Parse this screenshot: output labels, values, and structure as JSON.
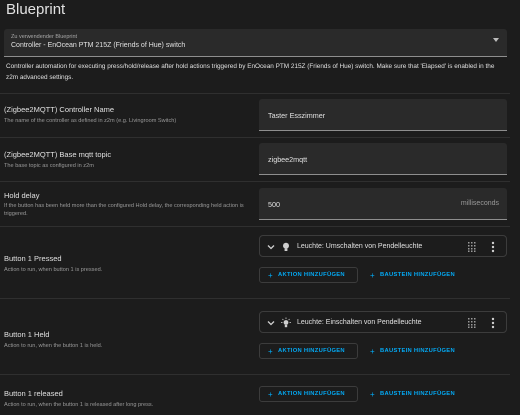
{
  "page": {
    "title": "Blueprint"
  },
  "blueprint_select": {
    "label": "Zu verwendender Blueprint",
    "value": "Controller - EnOcean PTM 215Z (Friends of Hue) switch"
  },
  "description": "Controller automation for executing press/hold/release after hold actions triggered by EnOcean PTM 215Z (Friends of Hue) switch. Make sure that 'Elapsed' is enabled in the z2m advanced settings.",
  "fields": [
    {
      "title": "(Zigbee2MQTT) Controller Name",
      "subtitle": "The name of the controller as defined in z2m (e.g. Livingroom Switch)",
      "value": "Taster Esszimmer"
    },
    {
      "title": "(Zigbee2MQTT) Base mqtt topic",
      "subtitle": "The base topic as configured in z2m",
      "value": "zigbee2mqtt"
    },
    {
      "title": "Hold delay",
      "subtitle": "If the button has been held more than the configured Hold delay, the corresponding held action is triggered.",
      "value": "500",
      "suffix": "milliseconds"
    }
  ],
  "actions": [
    {
      "title": "Button 1 Pressed",
      "subtitle": "Action to run, when button 1 is pressed.",
      "card": "Leuchte: Umschalten von Pendelleuchte"
    },
    {
      "title": "Button 1 Held",
      "subtitle": "Action to run, when the button 1 is held.",
      "card": "Leuchte: Einschalten von Pendelleuchte"
    },
    {
      "title": "Button 1 released",
      "subtitle": "Action to run, when the button 1 is released after long press.",
      "card": ""
    }
  ],
  "buttons": {
    "add_action": "AKTION HINZUFÜGEN",
    "add_block": "BAUSTEIN HINZUFÜGEN"
  },
  "colors": {
    "accent": "#03a9f4",
    "background": "#1c1c1c",
    "field": "#2a2a2a"
  },
  "icons": {
    "chevron": "chevron-down-icon",
    "bulb": "lightbulb-icon",
    "bulb_on": "lightbulb-on-icon",
    "drag": "drag-handle-icon",
    "more": "more-vertical-icon",
    "plus": "plus-icon"
  }
}
